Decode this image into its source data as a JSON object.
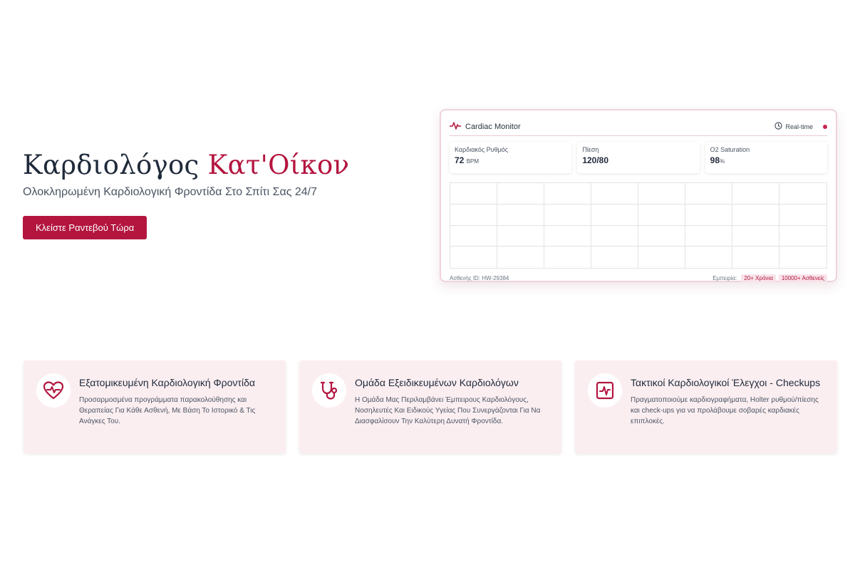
{
  "hero": {
    "title_main": "Καρδιολόγος ",
    "title_accent": "Κατ'Οίκον",
    "subtitle": "Ολοκληρωμένη Καρδιολογική Φροντίδα Στο Σπίτι Σας 24/7",
    "cta_label": "Κλείστε Ραντεβού Τώρα"
  },
  "monitor": {
    "title": "Cardiac Monitor",
    "realtime_label": "Real-time",
    "metrics": [
      {
        "label": "Καρδιακός Ρυθμός",
        "value": "72",
        "unit": "BPM"
      },
      {
        "label": "Πίεση",
        "value": "120/80",
        "unit": ""
      },
      {
        "label": "O2 Saturation",
        "value": "98",
        "unit": "%"
      }
    ],
    "patient_id": "Ασθενής ID: HW-29384",
    "experience_label": "Εμπειρία:",
    "badges": [
      "20+ Χρόνια",
      "10000+ Ασθενείς"
    ]
  },
  "features": [
    {
      "icon": "heart-pulse-icon",
      "title": "Εξατομικευμένη Καρδιολογική Φροντίδα",
      "desc": "Προσαρμοσμένα προγράμματα παρακολούθησης και Θεραπείας Για Κάθε Ασθενή, Με Βάση Το Ιστορικό & Τις Ανάγκες Του."
    },
    {
      "icon": "stethoscope-icon",
      "title": "Ομάδα Εξειδικευμένων Καρδιολόγων",
      "desc": "Η Ομάδα Μας Περιλαμβάνει Έμπειρους Καρδιολόγους, Νοσηλευτές Και Ειδικούς Υγείας Που Συνεργάζονται Για Να Διασφαλίσουν Την Καλύτερη Δυνατή Φροντίδα."
    },
    {
      "icon": "ecg-monitor-icon",
      "title": "Τακτικοί Καρδιολογικοί Έλεγχοι - Checkups",
      "desc": "Πραγματοποιούμε καρδιογραφήματα, Holter ρυθμού/πίεσης και check-ups για να προλάβουμε σοβαρές καρδιακές επιπλοκές."
    }
  ],
  "colors": {
    "accent": "#b3153f",
    "card_bg": "#fbeef1",
    "text_dark": "#1f2a3a"
  }
}
